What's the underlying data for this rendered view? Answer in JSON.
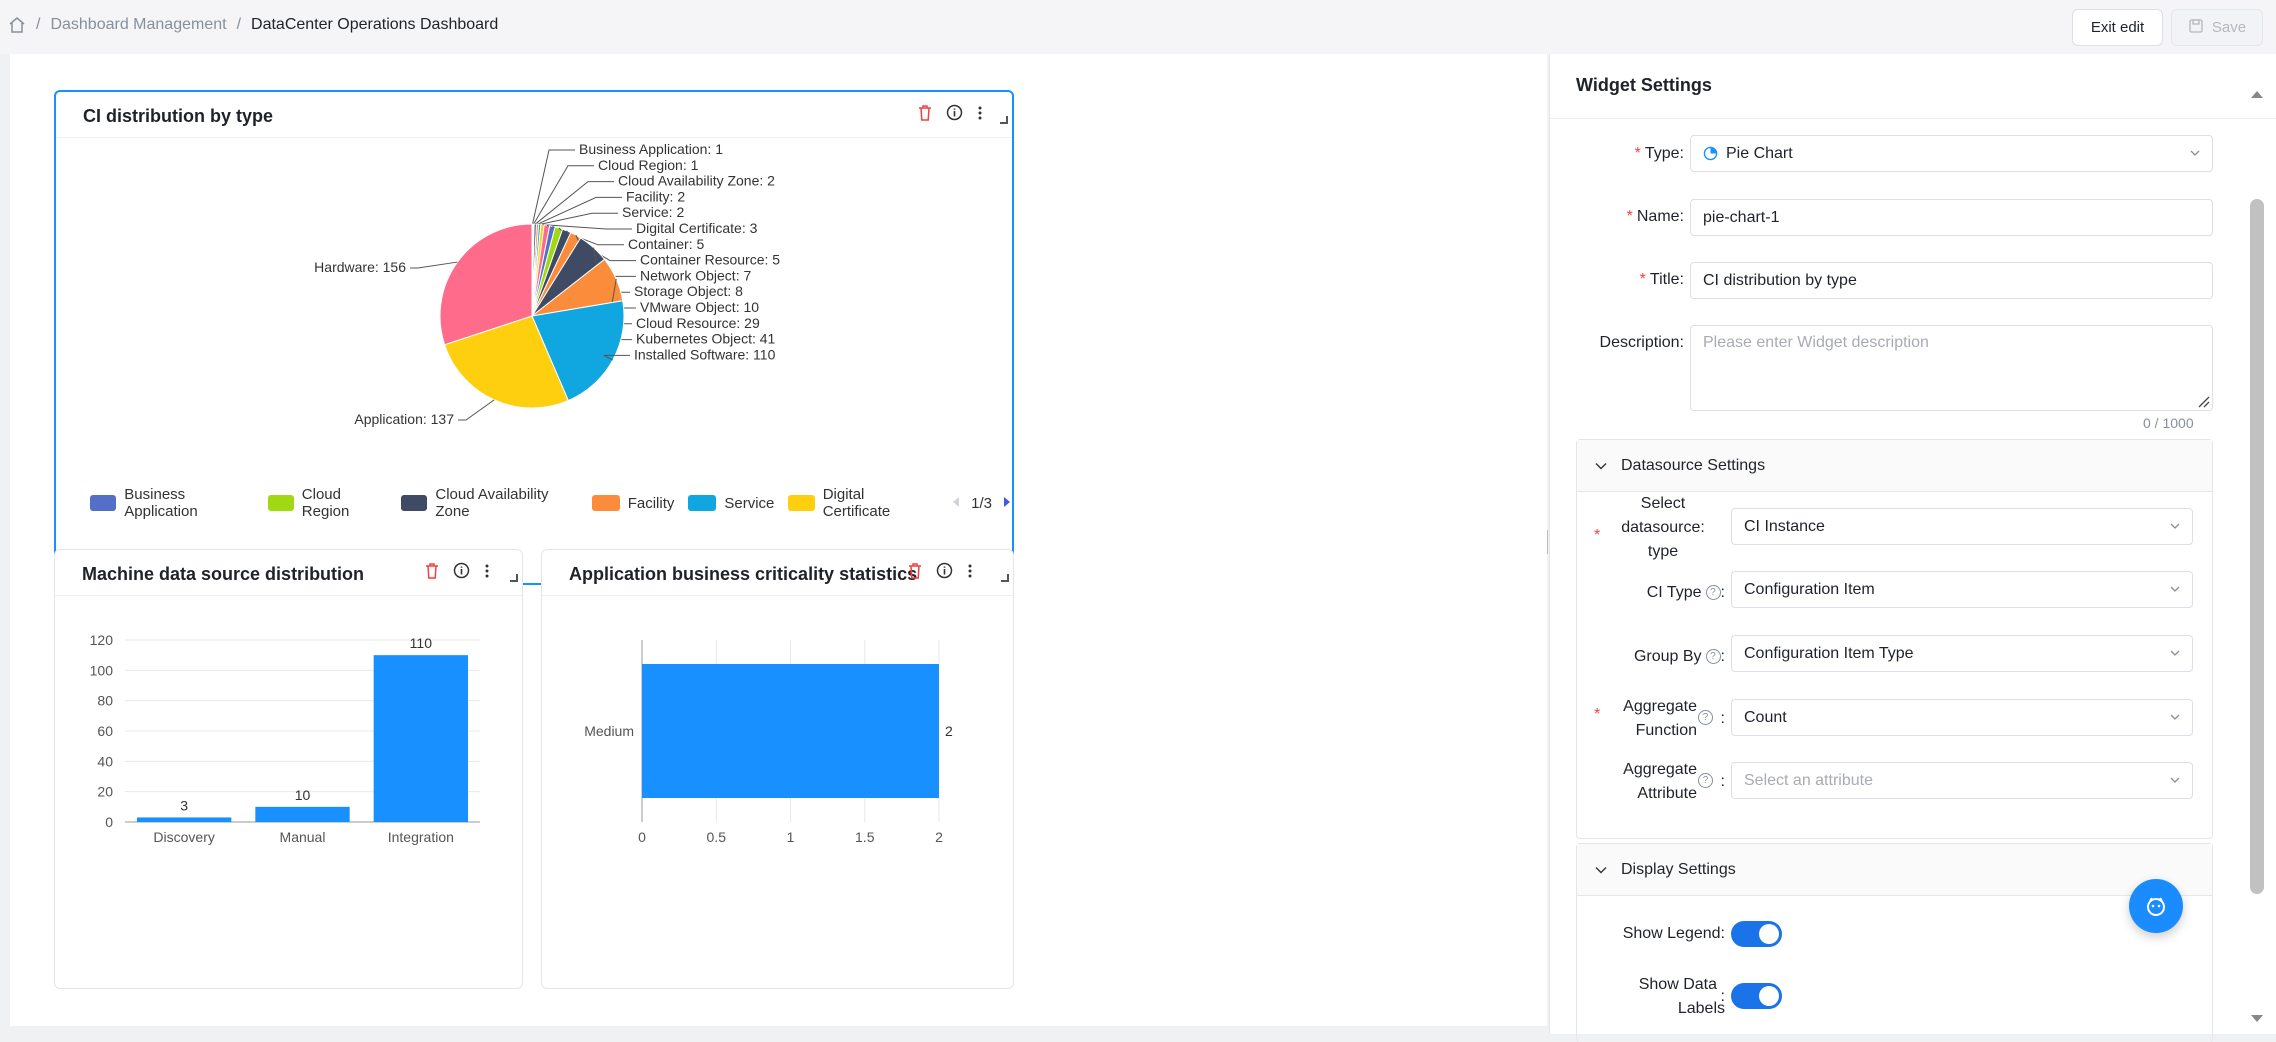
{
  "breadcrumb": {
    "items": [
      "Dashboard Management",
      "DataCenter Operations Dashboard"
    ]
  },
  "toolbar": {
    "exit_label": "Exit edit",
    "save_label": "Save"
  },
  "widgets": {
    "pie": {
      "title": "CI distribution by type",
      "legend": [
        "Business Application",
        "Cloud Region",
        "Cloud Availability Zone",
        "Facility",
        "Service",
        "Digital Certificate"
      ],
      "legend_colors": [
        "#5470c6",
        "#a0d911",
        "#3f4a64",
        "#fa8c3c",
        "#10a6e0",
        "#fecf0e"
      ],
      "pager": "1/3"
    },
    "machine": {
      "title": "Machine data source distribution"
    },
    "criticality": {
      "title": "Application business criticality statistics"
    }
  },
  "chart_data": [
    {
      "type": "pie",
      "title": "CI distribution by type",
      "labels": [
        "Business Application",
        "Cloud Region",
        "Cloud Availability Zone",
        "Facility",
        "Service",
        "Digital Certificate",
        "Container",
        "Container Resource",
        "Network Object",
        "Storage Object",
        "VMware Object",
        "Cloud Resource",
        "Kubernetes Object",
        "Installed Software",
        "Application",
        "Hardware"
      ],
      "values": [
        1,
        1,
        2,
        2,
        2,
        3,
        5,
        5,
        7,
        8,
        10,
        29,
        41,
        110,
        137,
        156
      ],
      "colors": [
        "#5470c6",
        "#a0d911",
        "#3f4a64",
        "#fa8c3c",
        "#10a6e0",
        "#fecf0e",
        "#ff6b8a",
        "#5470c6",
        "#a0d911",
        "#3f4a64",
        "#fa8c3c",
        "#3f4a64",
        "#fa8c3c",
        "#10a6e0",
        "#fecf0e",
        "#ff6b8a"
      ],
      "legend": "bottom",
      "data_labels": true
    },
    {
      "type": "bar",
      "title": "Machine data source distribution",
      "categories": [
        "Discovery",
        "Manual",
        "Integration"
      ],
      "values": [
        3,
        10,
        110
      ],
      "ylim": [
        0,
        120
      ],
      "yticks": [
        0,
        20,
        40,
        60,
        80,
        100,
        120
      ],
      "color": "#1890ff",
      "grid": true
    },
    {
      "type": "bar",
      "orientation": "horizontal",
      "title": "Application business criticality statistics",
      "categories": [
        "Medium"
      ],
      "values": [
        2
      ],
      "xlim": [
        0,
        2
      ],
      "xticks": [
        "0",
        "0.5",
        "1",
        "1.5",
        "2"
      ],
      "color": "#1890ff",
      "grid": true
    }
  ],
  "settings": {
    "title": "Widget Settings",
    "type_label": "Type",
    "type_value": "Pie Chart",
    "name_label": "Name",
    "name_value": "pie-chart-1",
    "title_label": "Title",
    "title_value": "CI distribution by type",
    "description_label": "Description",
    "description_placeholder": "Please enter Widget description",
    "description_count": "0 / 1000",
    "datasource_section": "Datasource Settings",
    "datasource_type_label_1": "Select",
    "datasource_type_label_2": "datasource",
    "datasource_type_label_3": "type",
    "datasource_type_value": "CI Instance",
    "ci_type_label": "CI Type",
    "ci_type_value": "Configuration Item",
    "group_by_label": "Group By",
    "group_by_value": "Configuration Item Type",
    "agg_func_label_1": "Aggregate",
    "agg_func_label_2": "Function",
    "agg_func_value": "Count",
    "agg_attr_label_1": "Aggregate",
    "agg_attr_label_2": "Attribute",
    "agg_attr_placeholder": "Select an attribute",
    "display_section": "Display Settings",
    "show_legend_label": "Show Legend",
    "show_data_labels_label_1": "Show Data",
    "show_data_labels_label_2": "Labels"
  }
}
